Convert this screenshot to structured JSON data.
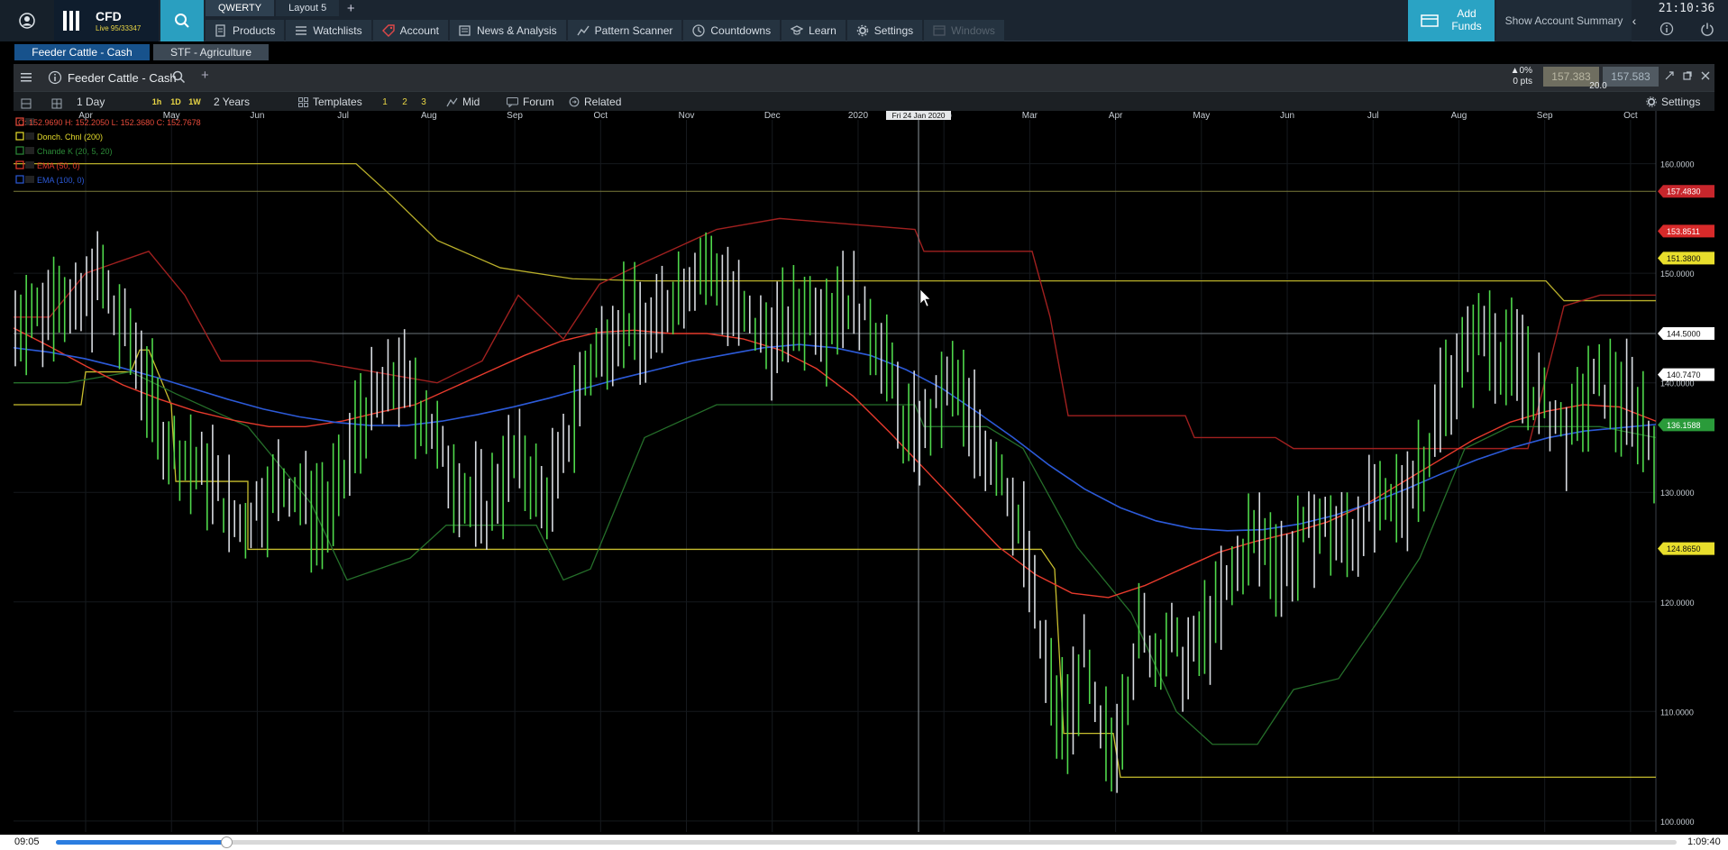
{
  "topbar": {
    "logo_title": "CFD",
    "logo_sub": "Live 95/33347",
    "layout_tabs": [
      "QWERTY",
      "Layout 5"
    ],
    "nav": [
      {
        "label": "Products",
        "icon": "document-icon",
        "name": "nav-products"
      },
      {
        "label": "Watchlists",
        "icon": "list-icon",
        "name": "nav-watchlists"
      },
      {
        "label": "Account",
        "icon": "tag-icon",
        "name": "nav-account"
      },
      {
        "label": "News & Analysis",
        "icon": "newspaper-icon",
        "name": "nav-news-analysis"
      },
      {
        "label": "Pattern Scanner",
        "icon": "scanner-icon",
        "name": "nav-pattern-scanner"
      },
      {
        "label": "Countdowns",
        "icon": "clock-icon",
        "name": "nav-countdowns"
      },
      {
        "label": "Learn",
        "icon": "graduation-cap-icon",
        "name": "nav-learn"
      },
      {
        "label": "Settings",
        "icon": "gear-icon",
        "name": "nav-settings"
      },
      {
        "label": "Windows",
        "icon": "windows-icon",
        "name": "nav-windows",
        "disabled": true
      }
    ],
    "add_funds": "Add Funds",
    "account_summary": "Show Account Summary",
    "clock": "21:10:36"
  },
  "product_tabs": [
    "Feeder Cattle - Cash",
    "STF - Agriculture"
  ],
  "chart_header": {
    "instrument": "Feeder Cattle - Cash",
    "change_pct": "▲0%",
    "change_pts": "0 pts",
    "sell": "157.383",
    "buy": "157.583",
    "spread": "20.0"
  },
  "toolbar": {
    "interval": "1 Day",
    "tf_buttons": [
      "1h",
      "1D",
      "1W"
    ],
    "range": "2 Years",
    "templates": "Templates",
    "template_slots": [
      "1",
      "2",
      "3"
    ],
    "mid": "Mid",
    "forum": "Forum",
    "related": "Related",
    "settings": "Settings"
  },
  "chart_data": {
    "type": "line",
    "months": [
      "Apr",
      "May",
      "Jun",
      "Jul",
      "Aug",
      "Sep",
      "Oct",
      "Nov",
      "Dec",
      "2020",
      "Feb",
      "Mar",
      "Apr",
      "May",
      "Jun",
      "Jul",
      "Aug",
      "Sep",
      "Oct"
    ],
    "crosshair_date": "Fri 24 Jan 2020",
    "y_ticks": [
      "160.0000",
      "150.0000",
      "140.0000",
      "130.0000",
      "120.0000",
      "110.0000",
      "100.0000"
    ],
    "ylim": [
      99,
      164
    ],
    "price_labels": [
      {
        "value": "157.4830",
        "price": 157.48,
        "color": "#c8262c"
      },
      {
        "value": "153.8511",
        "price": 153.85,
        "color": "#d82a2a"
      },
      {
        "value": "151.3800",
        "price": 151.38,
        "color": "#e8de2c"
      },
      {
        "value": "144.5000",
        "price": 144.5,
        "color": "#ffffff"
      },
      {
        "value": "140.7470",
        "price": 140.75,
        "color": "#ffffff"
      },
      {
        "value": "136.1588",
        "price": 136.16,
        "color": "#2a9b3a"
      },
      {
        "value": "124.8650",
        "price": 124.87,
        "color": "#e8de2c"
      }
    ],
    "legend": [
      {
        "label": "O: 152.9690   H: 152.2050   L: 152.3680   C: 152.7678",
        "color": "#e84b3b"
      },
      {
        "label": "Donch. Chnl (200)",
        "color": "#e8de2c"
      },
      {
        "label": "Chande K (20, 5, 20)",
        "color": "#2c8a38"
      },
      {
        "label": "EMA (50, 0)",
        "color": "#e63a2c"
      },
      {
        "label": "EMA (100, 0)",
        "color": "#2c5ad8"
      }
    ],
    "series": [
      {
        "name": "Price",
        "color": "#4fd84b",
        "values": [
          145,
          147,
          146,
          149,
          146,
          148,
          150,
          146,
          144,
          141,
          136,
          134,
          133,
          132,
          131,
          128,
          127,
          129,
          130,
          131,
          130,
          128,
          128,
          131,
          136,
          138,
          139,
          141,
          138,
          137,
          133,
          131,
          129,
          128,
          131,
          133,
          132,
          129,
          131,
          136,
          141,
          143,
          145,
          146,
          144,
          145,
          148,
          149,
          151,
          150,
          148,
          146,
          145,
          144,
          145,
          146,
          147,
          146,
          148,
          147,
          145,
          143,
          137,
          135,
          136,
          139,
          140,
          136,
          134,
          133,
          129,
          124,
          116,
          110,
          109,
          115,
          108,
          106,
          112,
          118,
          115,
          117,
          114,
          116,
          118,
          121,
          124,
          126,
          125,
          123,
          125,
          127,
          127,
          126,
          126,
          129,
          128,
          129,
          131,
          133,
          138,
          141,
          143,
          145,
          143,
          142,
          141,
          138,
          137,
          135,
          138,
          140,
          139,
          138,
          137,
          134
        ]
      },
      {
        "name": "EMA (50, 0)",
        "color": "#e63a2c",
        "values": [
          145,
          143.3,
          141.5,
          139.8,
          138.5,
          137.4,
          136.6,
          136,
          136,
          136.5,
          137.3,
          138,
          139.5,
          141,
          142.5,
          143.8,
          144.6,
          144.8,
          144.5,
          144.5,
          144,
          143,
          141.3,
          138.8,
          135.5,
          132,
          128.5,
          125,
          122.5,
          120.8,
          120.4,
          121.5,
          123,
          124.5,
          125.5,
          126.3,
          127.3,
          128.8,
          130.8,
          132.8,
          134.8,
          136.4,
          137.4,
          138,
          137.8,
          136.5
        ]
      },
      {
        "name": "EMA (100, 0)",
        "color": "#2c5ad8",
        "values": [
          143.2,
          142.8,
          142.2,
          141.4,
          140.5,
          139.5,
          138.5,
          137.6,
          136.9,
          136.4,
          136.1,
          136.1,
          136.5,
          137.1,
          137.8,
          138.6,
          139.5,
          140.4,
          141.2,
          142,
          142.6,
          143.2,
          143.5,
          143.2,
          142.5,
          141.2,
          139.5,
          137.3,
          135,
          132.5,
          130.3,
          128.6,
          127.4,
          126.7,
          126.5,
          126.6,
          127.1,
          127.9,
          129,
          130.3,
          131.7,
          133,
          134.1,
          135,
          135.6,
          135.9,
          136.2
        ]
      }
    ]
  },
  "video": {
    "elapsed": "09:05",
    "total": "1:09:40",
    "progress": 0.105
  }
}
